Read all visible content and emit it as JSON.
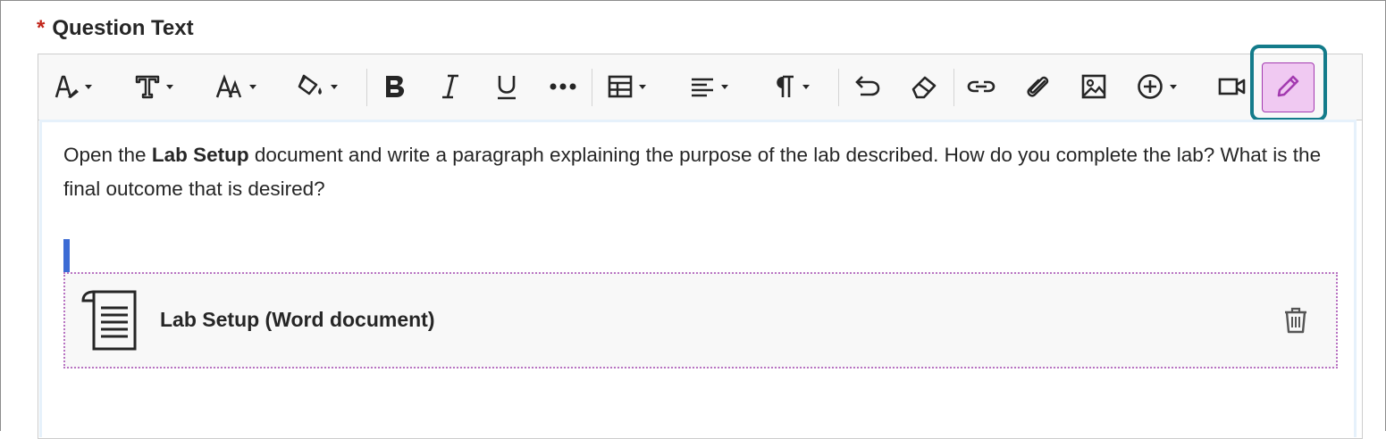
{
  "field": {
    "required_marker": "*",
    "label": "Question Text"
  },
  "toolbar": {
    "buttons": [
      {
        "name": "text-style-icon",
        "has_menu": true
      },
      {
        "name": "font-icon",
        "has_menu": true
      },
      {
        "name": "font-size-icon",
        "has_menu": true
      },
      {
        "name": "fill-color-icon",
        "has_menu": true
      },
      {
        "name": "bold-icon",
        "has_menu": false
      },
      {
        "name": "italic-icon",
        "has_menu": false
      },
      {
        "name": "underline-icon",
        "has_menu": false
      },
      {
        "name": "more-icon",
        "has_menu": false
      },
      {
        "name": "table-icon",
        "has_menu": true
      },
      {
        "name": "align-icon",
        "has_menu": true
      },
      {
        "name": "paragraph-icon",
        "has_menu": true
      },
      {
        "name": "undo-icon",
        "has_menu": false
      },
      {
        "name": "eraser-icon",
        "has_menu": false
      },
      {
        "name": "link-icon",
        "has_menu": false
      },
      {
        "name": "attach-icon",
        "has_menu": false
      },
      {
        "name": "image-icon",
        "has_menu": false
      },
      {
        "name": "insert-plus-icon",
        "has_menu": true
      },
      {
        "name": "video-icon",
        "has_menu": false
      },
      {
        "name": "pencil-icon",
        "has_menu": false,
        "active": true
      }
    ],
    "active_color": "#f0c9f2",
    "highlight_color": "#137b8a"
  },
  "content": {
    "para_part1": "Open the ",
    "para_bold": "Lab Setup",
    "para_part2": " document and write a paragraph explaining the purpose of the lab described. How do you complete the lab? What is the final outcome that is desired?"
  },
  "attachment": {
    "title": "Lab Setup (Word document)",
    "icon": "document-icon",
    "border_color": "#b873c2"
  },
  "colors": {
    "required": "#c2251a",
    "cursor": "#3c6bd4"
  }
}
